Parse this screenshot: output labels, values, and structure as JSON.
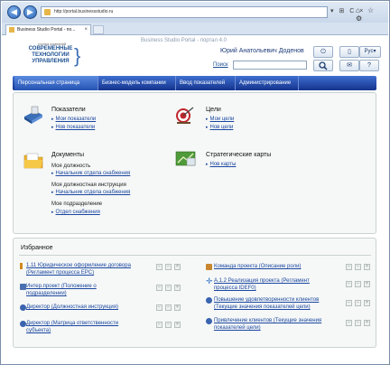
{
  "browser": {
    "address_url": "http://portal.businessstudio.ru",
    "tab_title": "Business Studio Portal - по...",
    "page_watermark": "Business Studio Portal - портал 4.0",
    "addr_tools": "▾ ⊞ C ×",
    "win_tools": "⌂ ☆ ⚙"
  },
  "header": {
    "logo_small": "группа компаний",
    "logo_line1": "СОВРЕМЕННЫЕ",
    "logo_line2": "ТЕХНОЛОГИИ",
    "logo_line3": "УПРАВЛЕНИЯ",
    "user_name": "Юрий Анатольевич Доденов",
    "search_label": "Поиск",
    "lang_label": "Рус"
  },
  "menu": [
    {
      "label": "Персональная страница",
      "active": true
    },
    {
      "label": "Бизнес-модель компании",
      "active": false
    },
    {
      "label": "Ввод показателей",
      "active": false
    },
    {
      "label": "Администрирование",
      "active": false
    }
  ],
  "sections": {
    "indicators": {
      "title": "Показатели",
      "links": [
        "Мои показатели",
        "Нов показатели"
      ]
    },
    "goals": {
      "title": "Цели",
      "links": [
        "Мои цели",
        "Нов цели"
      ]
    },
    "documents": {
      "title": "Документы",
      "position_label": "Моя должность",
      "position_link": "Начальник отдела снабжения",
      "instruction_label": "Моя должностная инструкция",
      "instruction_link": "Начальник отдела снабжения",
      "department_label": "Мое подразделение",
      "department_link": "Отдел снабжения"
    },
    "maps": {
      "title": "Стратегические карты",
      "links": [
        "Нов карты"
      ]
    }
  },
  "favorites": {
    "title": "Избранное",
    "left": [
      {
        "line1": "1.11 Юридическое оформление договора",
        "line2": "(Регламент процесса EPC)",
        "icon_color": "#d08a1c"
      },
      {
        "line1": "Интер.проект (Положение о",
        "line2": "подразделении)",
        "icon_color": "#4a6fb0"
      },
      {
        "line1": "Директор (Должностная инструкция)",
        "line2": "",
        "icon_color": "#3a63b0"
      },
      {
        "line1": "Директор (Матрица ответственности",
        "line2": "субъекта)",
        "icon_color": "#3a63b0"
      }
    ],
    "right": [
      {
        "line1": "Команда проекта (Описание роли)",
        "line2": "",
        "icon_color": "#c8872e"
      },
      {
        "line1": "A.1.2 Реализация проекта (Регламент",
        "line2": "процесса IDEF0)",
        "icon_color": "#2c6fc4"
      },
      {
        "line1": "Повышение удовлетворенности клиентов",
        "line2": "(Текущие значения показателей цели)",
        "icon_color": "#3a63b0"
      },
      {
        "line1": "Привлечение клиентов (Текущие значения",
        "line2": "показателей цели)",
        "icon_color": "#3a63b0"
      }
    ]
  }
}
